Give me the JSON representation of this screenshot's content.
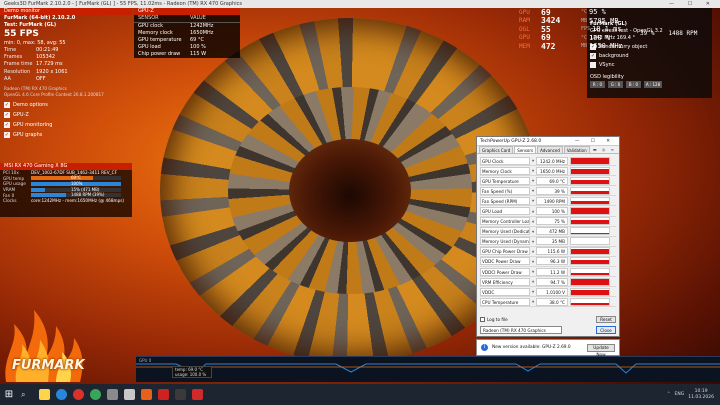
{
  "window_title": "Geeks3D FurMark 2.10.2.0 - [ FurMark (GL) ] - 55 FPS, 11.02ms - Radeon (TM) RX 470 Graphics",
  "window_controls": "—  ☐  ✕",
  "furmark": {
    "header": "Demo monitor",
    "version_line": "FurMark (64-bit) 2.10.2.0",
    "test_line": "Test: FurMark (GL)",
    "fps": "55 FPS",
    "fps_stats": "min: 0, max: 58, avg: 55",
    "stats": [
      {
        "k": "Time",
        "v": "00:21:49"
      },
      {
        "k": "Frames",
        "v": "105342"
      },
      {
        "k": "Frame time",
        "v": "17.729 ms"
      },
      {
        "k": "Resolution",
        "v": "1920 x 1061"
      },
      {
        "k": "AA",
        "v": "OFF"
      }
    ],
    "renderer": "Radeon (TM) RX 470 Graphics",
    "opengl": "OpenGL 4.6 Core Profile Context 20.8.1.200817",
    "options": [
      {
        "label": "Demo options",
        "mark": "✓"
      },
      {
        "label": "GPU-Z",
        "mark": "✓"
      },
      {
        "label": "GPU monitoring",
        "mark": "✓"
      },
      {
        "label": "GPU graphs",
        "mark": "✓"
      }
    ]
  },
  "monitor": {
    "header": "MSI RX 470 Gaming X 8G",
    "pci": "PCI 10x",
    "pci_val": "DEV_1002-67DF SUB_1462-3411 REV_CF",
    "rows": [
      {
        "k": "GPU temp",
        "label": "69°C",
        "pct": 0.69,
        "color": "#e36a12"
      },
      {
        "k": "GPU usage",
        "label": "100%",
        "pct": 1.0,
        "color": "#2a86d8"
      },
      {
        "k": "VRAM",
        "label": "15% (471 MB)",
        "pct": 0.15,
        "color": "#2a86d8"
      },
      {
        "k": "Fan 0",
        "label": "1488 RPM (39%)",
        "pct": 0.39,
        "color": "#2a86d8"
      }
    ],
    "clocks_k": "Clocks",
    "clocks_v": "core:1242MHz - mem:1650MHz (@ 468mps)"
  },
  "gpuz": {
    "header": "GPU-Z",
    "col_sensor": "SENSOR",
    "col_value": "VALUE",
    "rows": [
      {
        "k": "GPU clock",
        "v": "1242MHz"
      },
      {
        "k": "Memory clock",
        "v": "1650MHz"
      },
      {
        "k": "GPU temperature",
        "v": "69 °C"
      },
      {
        "k": "GPU load",
        "v": "100 %"
      },
      {
        "k": "Chip power draw",
        "v": "115 W"
      }
    ]
  },
  "osd": {
    "rows": [
      {
        "lab": "GPU",
        "big": "69",
        "unit": "°C",
        "rest": "95 %"
      },
      {
        "lab": "RAM",
        "big": "3424",
        "unit": "MB",
        "rest": "5785 MB"
      },
      {
        "lab": "OGL",
        "big": "55",
        "unit": "FPS",
        "rest": "18.1 ms"
      },
      {
        "lab": "GPU",
        "big": "69",
        "unit": "°C",
        "rest": "100 %"
      },
      {
        "lab": "MEM",
        "big": "472",
        "unit": "MB",
        "rest": "1650 MHz"
      }
    ],
    "extra": [
      "39 %",
      "1488 RPM"
    ]
  },
  "rtss": {
    "title": "FurMark (GL)",
    "line2": "GPU stress test - OpenGL 3.2",
    "line3": "1242 MHz   169.4 °",
    "options": [
      {
        "label": "Render furry object",
        "mark": "✓"
      },
      {
        "label": "background",
        "mark": "✓"
      },
      {
        "label": "VSync",
        "mark": ""
      }
    ],
    "osd_label": "OSD legibility",
    "buttons": [
      "R : 0",
      "G : 0",
      "B : 0",
      "A : 128"
    ]
  },
  "tpu": {
    "title": "TechPowerUp GPU-Z 2.68.0",
    "tabs": [
      "Graphics Card",
      "Sensors",
      "Advanced",
      "Validation"
    ],
    "tab_icons": "▬ ◎ ≡",
    "sensors": [
      {
        "n": "GPU Clock",
        "v": "1242.0 MHz",
        "f": 0.85
      },
      {
        "n": "Memory Clock",
        "v": "1650.0 MHz",
        "f": 0.85
      },
      {
        "n": "GPU Temperature",
        "v": "69.0 °C",
        "f": 0.7
      },
      {
        "n": "Fan Speed (%)",
        "v": "39 %",
        "f": 0.4
      },
      {
        "n": "Fan Speed (RPM)",
        "v": "1490 RPM",
        "f": 0.55
      },
      {
        "n": "GPU Load",
        "v": "100 %",
        "f": 1.0
      },
      {
        "n": "Memory Controller Load",
        "v": "75 %",
        "f": 0.75
      },
      {
        "n": "Memory Used (Dedicated)",
        "v": "472 MB",
        "f": 0.2
      },
      {
        "n": "Memory Used (Dynamic)",
        "v": "35 MB",
        "f": 0.05
      },
      {
        "n": "GPU Chip Power Draw",
        "v": "115.6 W",
        "f": 0.9
      },
      {
        "n": "VDDC Power Draw",
        "v": "96.3 W",
        "f": 0.8
      },
      {
        "n": "VDDCI Power Draw",
        "v": "11.2 W",
        "f": 0.3
      },
      {
        "n": "VRM Efficiency",
        "v": "94.7 %",
        "f": 0.95
      },
      {
        "n": "VDDC",
        "v": "1.0100 V",
        "f": 0.8
      },
      {
        "n": "CPU Temperature",
        "v": "38.0 °C",
        "f": 0.38
      }
    ],
    "log_label": "Log to file",
    "reset": "Reset",
    "device": "Radeon (TM) RX 470 Graphics",
    "close": "Close"
  },
  "notice": {
    "text": "New version available: GPU-Z 2.69.0",
    "btn": "Update Now"
  },
  "graph": {
    "title": "GPU 0",
    "legend": [
      "temp: 69.0 °C",
      "usage: 100.0 %"
    ]
  },
  "logo": "FURMARK",
  "taskbar": {
    "lang": "ENG",
    "time": "10:19",
    "date": "11.03.2026"
  }
}
